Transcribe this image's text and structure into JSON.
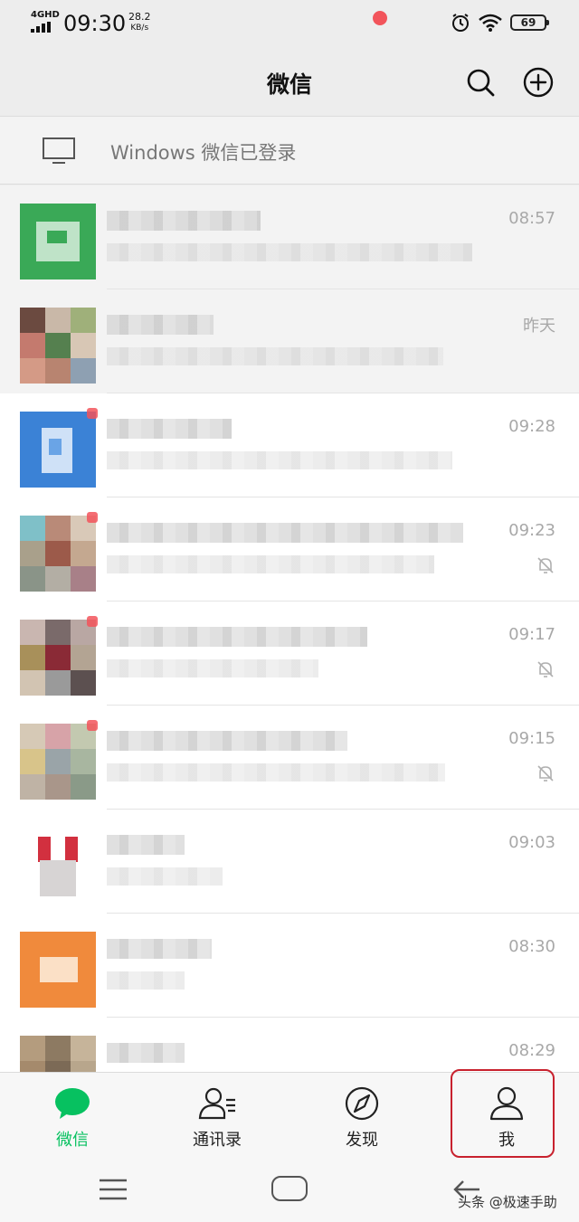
{
  "status_bar": {
    "network": "4GHD",
    "time": "09:30",
    "speed_value": "28.2",
    "speed_unit": "KB/s",
    "battery": "69"
  },
  "header": {
    "title": "微信",
    "search_icon": "search-icon",
    "add_icon": "plus-circle-icon"
  },
  "windows_banner": {
    "text": "Windows 微信已登录",
    "icon": "monitor-icon"
  },
  "chats": [
    {
      "time": "08:57",
      "muted": false
    },
    {
      "time": "昨天",
      "muted": false
    },
    {
      "time": "09:28",
      "muted": false
    },
    {
      "time": "09:23",
      "muted": true
    },
    {
      "time": "09:17",
      "muted": true
    },
    {
      "time": "09:15",
      "muted": true
    },
    {
      "time": "09:03",
      "muted": false
    },
    {
      "time": "08:30",
      "muted": false
    },
    {
      "time": "08:29",
      "muted": false
    }
  ],
  "tabs": [
    {
      "label": "微信",
      "icon": "chat-bubble-icon",
      "active": true
    },
    {
      "label": "通讯录",
      "icon": "contacts-icon",
      "active": false
    },
    {
      "label": "发现",
      "icon": "compass-icon",
      "active": false,
      "badge": true
    },
    {
      "label": "我",
      "icon": "person-icon",
      "active": false
    }
  ],
  "colors": {
    "accent": "#07c160",
    "badge": "#f2545b",
    "highlight": "#c8212e"
  },
  "watermark": "头条 @极速手助"
}
